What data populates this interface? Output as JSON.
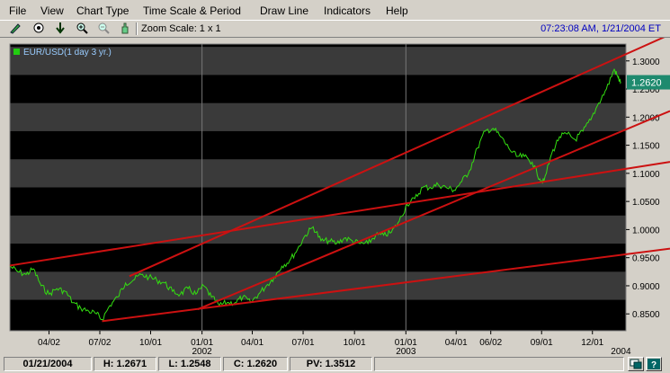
{
  "menu": [
    "File",
    "View",
    "Chart Type",
    "Time Scale & Period",
    "Draw Line",
    "Indicators",
    "Help"
  ],
  "toolbar": {
    "zoom_label": "Zoom Scale: 1 x 1",
    "clock": "07:23:08 AM, 1/21/2004 ET",
    "icons": [
      "pencil-icon",
      "target-icon",
      "down-arrow-icon",
      "zoom-in-icon",
      "zoom-out-icon",
      "hand-icon"
    ]
  },
  "chart_data": {
    "type": "line",
    "legend": "EUR/USD(1 day  3 yr.)",
    "current_price": "1.2620",
    "ylim": [
      0.82,
      1.33
    ],
    "yticks": [
      "1.3000",
      "1.2500",
      "1.2000",
      "1.1500",
      "1.1000",
      "1.0500",
      "1.0000",
      "0.9500",
      "0.9000",
      "0.8500"
    ],
    "xticks": [
      {
        "label": "04/02",
        "year": ""
      },
      {
        "label": "07/02",
        "year": ""
      },
      {
        "label": "10/01",
        "year": ""
      },
      {
        "label": "01/01",
        "year": "2002"
      },
      {
        "label": "04/01",
        "year": ""
      },
      {
        "label": "07/01",
        "year": ""
      },
      {
        "label": "10/01",
        "year": ""
      },
      {
        "label": "01/01",
        "year": "2003"
      },
      {
        "label": "04/01",
        "year": ""
      },
      {
        "label": "06/02",
        "year": ""
      },
      {
        "label": "09/01",
        "year": ""
      },
      {
        "label": "12/01",
        "year": ""
      },
      {
        "label": "",
        "year": "2004"
      }
    ],
    "series": [
      {
        "color": "#33dd11",
        "points": [
          [
            "2001-01-22",
            0.935
          ],
          [
            "2001-02-05",
            0.925
          ],
          [
            "2001-02-20",
            0.92
          ],
          [
            "2001-03-05",
            0.93
          ],
          [
            "2001-03-19",
            0.9
          ],
          [
            "2001-04-02",
            0.885
          ],
          [
            "2001-04-16",
            0.895
          ],
          [
            "2001-05-01",
            0.89
          ],
          [
            "2001-05-15",
            0.87
          ],
          [
            "2001-05-29",
            0.86
          ],
          [
            "2001-06-12",
            0.855
          ],
          [
            "2001-06-26",
            0.85
          ],
          [
            "2001-07-06",
            0.84
          ],
          [
            "2001-07-20",
            0.865
          ],
          [
            "2001-08-03",
            0.88
          ],
          [
            "2001-08-17",
            0.905
          ],
          [
            "2001-08-31",
            0.91
          ],
          [
            "2001-09-14",
            0.92
          ],
          [
            "2001-09-28",
            0.915
          ],
          [
            "2001-10-12",
            0.91
          ],
          [
            "2001-10-26",
            0.905
          ],
          [
            "2001-11-09",
            0.89
          ],
          [
            "2001-11-23",
            0.885
          ],
          [
            "2001-12-07",
            0.895
          ],
          [
            "2001-12-21",
            0.885
          ],
          [
            "2002-01-04",
            0.9
          ],
          [
            "2002-01-18",
            0.88
          ],
          [
            "2002-02-01",
            0.865
          ],
          [
            "2002-02-15",
            0.87
          ],
          [
            "2002-03-01",
            0.87
          ],
          [
            "2002-03-15",
            0.88
          ],
          [
            "2002-03-29",
            0.87
          ],
          [
            "2002-04-12",
            0.885
          ],
          [
            "2002-04-26",
            0.9
          ],
          [
            "2002-05-10",
            0.915
          ],
          [
            "2002-05-24",
            0.935
          ],
          [
            "2002-06-07",
            0.945
          ],
          [
            "2002-06-21",
            0.965
          ],
          [
            "2002-07-05",
            0.99
          ],
          [
            "2002-07-19",
            1.005
          ],
          [
            "2002-08-02",
            0.98
          ],
          [
            "2002-08-16",
            0.98
          ],
          [
            "2002-08-30",
            0.975
          ],
          [
            "2002-09-13",
            0.985
          ],
          [
            "2002-09-27",
            0.98
          ],
          [
            "2002-10-11",
            0.975
          ],
          [
            "2002-10-25",
            0.975
          ],
          [
            "2002-11-08",
            0.99
          ],
          [
            "2002-11-22",
            0.99
          ],
          [
            "2002-12-06",
            0.995
          ],
          [
            "2002-12-20",
            1.015
          ],
          [
            "2003-01-03",
            1.045
          ],
          [
            "2003-01-17",
            1.055
          ],
          [
            "2003-01-31",
            1.075
          ],
          [
            "2003-02-14",
            1.075
          ],
          [
            "2003-02-28",
            1.08
          ],
          [
            "2003-03-14",
            1.075
          ],
          [
            "2003-03-28",
            1.07
          ],
          [
            "2003-04-11",
            1.085
          ],
          [
            "2003-04-25",
            1.105
          ],
          [
            "2003-05-09",
            1.145
          ],
          [
            "2003-05-23",
            1.175
          ],
          [
            "2003-06-06",
            1.18
          ],
          [
            "2003-06-20",
            1.165
          ],
          [
            "2003-07-04",
            1.145
          ],
          [
            "2003-07-18",
            1.13
          ],
          [
            "2003-08-01",
            1.13
          ],
          [
            "2003-08-15",
            1.12
          ],
          [
            "2003-08-29",
            1.09
          ],
          [
            "2003-09-05",
            1.085
          ],
          [
            "2003-09-19",
            1.135
          ],
          [
            "2003-10-03",
            1.165
          ],
          [
            "2003-10-17",
            1.17
          ],
          [
            "2003-10-31",
            1.16
          ],
          [
            "2003-11-14",
            1.175
          ],
          [
            "2003-11-28",
            1.195
          ],
          [
            "2003-12-12",
            1.225
          ],
          [
            "2003-12-26",
            1.25
          ],
          [
            "2004-01-09",
            1.285
          ],
          [
            "2004-01-16",
            1.27
          ],
          [
            "2004-01-21",
            1.262
          ]
        ]
      }
    ],
    "trendlines": [
      {
        "color": "#cc1111",
        "from": [
          "2001-01-22",
          0.936
        ],
        "to": [
          "2004-01-30",
          1.108
        ]
      },
      {
        "color": "#cc1111",
        "from": [
          "2001-07-06",
          0.837
        ],
        "to": [
          "2004-01-30",
          0.956
        ]
      },
      {
        "color": "#cc1111",
        "from": [
          "2001-08-24",
          0.917
        ],
        "to": [
          "2004-01-30",
          1.312
        ]
      },
      {
        "color": "#cc1111",
        "from": [
          "2001-12-24",
          0.858
        ],
        "to": [
          "2004-01-30",
          1.178
        ]
      }
    ]
  },
  "status": {
    "date": "01/21/2004",
    "high": "H: 1.2671",
    "low": "L: 1.2548",
    "close": "C: 1.2620",
    "pv": "PV: 1.3512"
  }
}
